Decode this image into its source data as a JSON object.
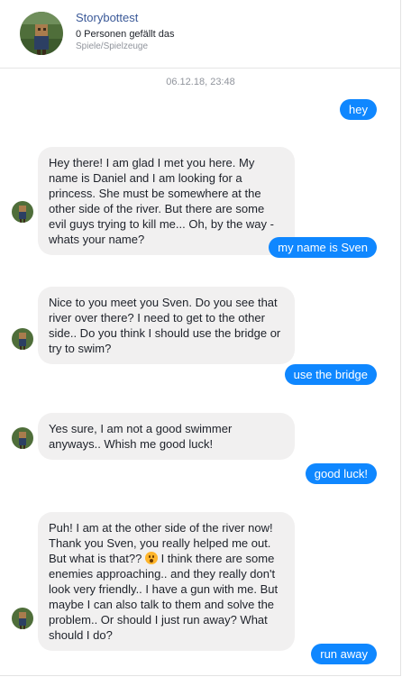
{
  "header": {
    "page_name": "Storybottest",
    "likes": "0 Personen gefällt das",
    "category": "Spiele/Spielzeuge"
  },
  "timestamp": "06.12.18, 23:48",
  "messages": [
    {
      "from": "user",
      "text": "hey"
    },
    {
      "from": "bot",
      "text": "Hey there! I am glad I met you here. My name is Daniel and I am looking for a princess. She must be somewhere at the other side of the river. But there are some evil guys trying to kill me... Oh, by the way - whats your name?"
    },
    {
      "from": "user",
      "text": "my name is Sven"
    },
    {
      "from": "bot",
      "text": "Nice to you meet you Sven. Do you see that river over there? I need to get to the other side.. Do you think I should use the bridge or try to swim?"
    },
    {
      "from": "user",
      "text": "use the bridge"
    },
    {
      "from": "bot",
      "text": "Yes sure, I am not a good swimmer anyways.. Whish me good luck!"
    },
    {
      "from": "user",
      "text": "good luck!"
    },
    {
      "from": "bot",
      "text_before_emoji": "Puh! I am at the other side of the river now! Thank you Sven, you really helped me out. But what is that?? ",
      "emoji": "astonished-face",
      "text_after_emoji": " I think there are some enemies approaching.. and they really don't look very friendly.. I have a gun with me. But maybe I can also talk to them and solve the problem.. Or should I just run away? What should I do?"
    },
    {
      "from": "user",
      "text": "run away"
    }
  ],
  "colors": {
    "user_bubble": "#0f87ff",
    "bot_bubble": "#f1f0f0",
    "page_name": "#3b5998"
  }
}
